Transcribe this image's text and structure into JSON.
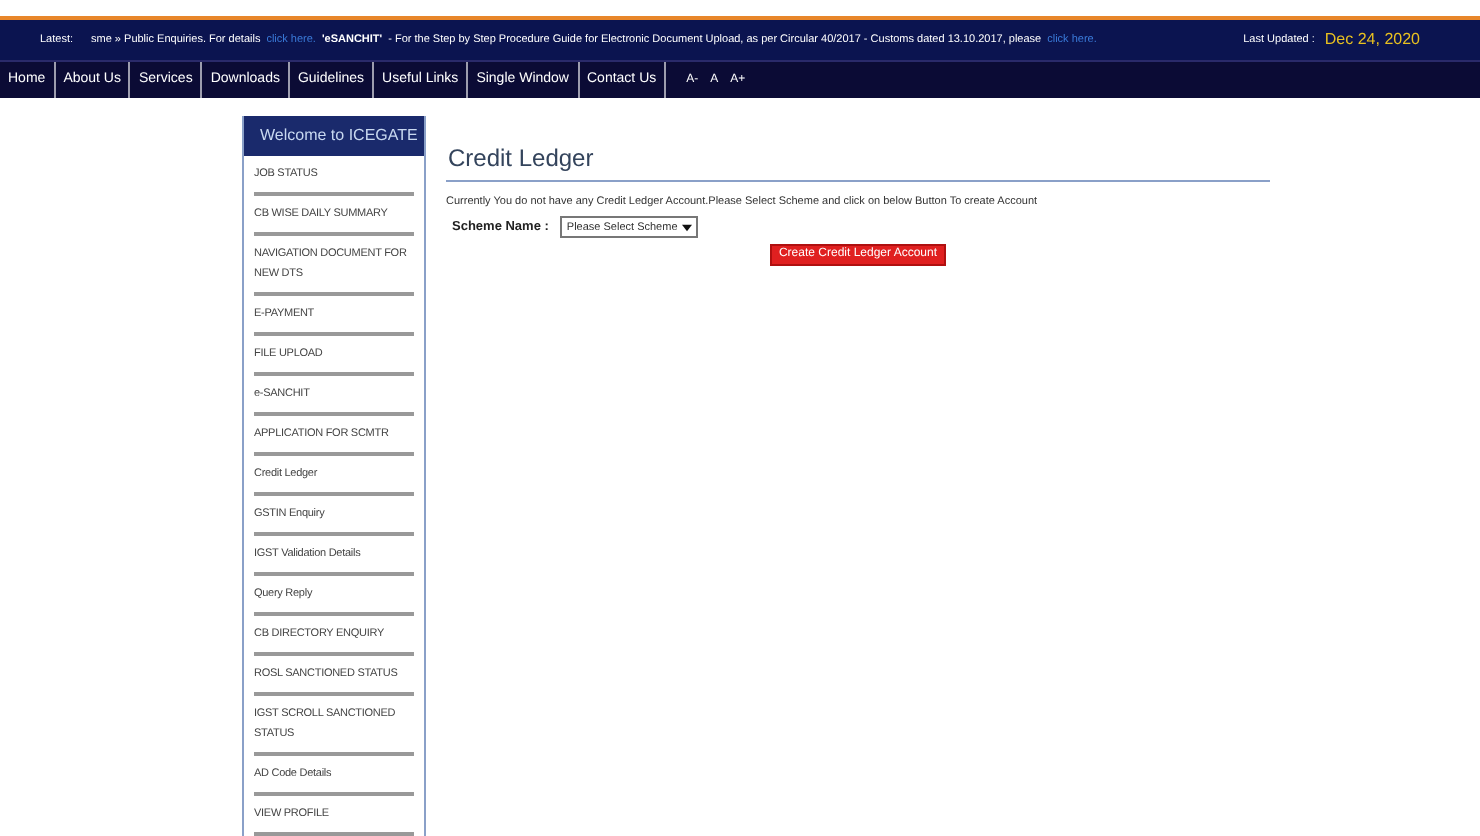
{
  "ticker": {
    "label": "Latest:",
    "items": [
      {
        "kind": "text",
        "text": "sme » Public Enquiries. For details"
      },
      {
        "kind": "link",
        "text": "click here."
      },
      {
        "kind": "bold",
        "text": "'eSANCHIT'"
      },
      {
        "kind": "text",
        "text": "- For the Step by Step Procedure Guide for Electronic Document Upload, as per Circular 40/2017 - Customs dated 13.10.2017, please"
      },
      {
        "kind": "link",
        "text": "click here."
      }
    ],
    "updated_label": "Last Updated :",
    "updated_date": "Dec 24, 2020"
  },
  "nav": [
    "Home",
    "About Us",
    "Services",
    "Downloads",
    "Guidelines",
    "Useful Links",
    "Single Window",
    "Contact Us"
  ],
  "font_sizes": [
    "A-",
    "A",
    "A+"
  ],
  "sidebar": {
    "title": "Welcome to ICEGATE",
    "items": [
      {
        "label": "JOB STATUS"
      },
      {
        "label": "CB WISE DAILY SUMMARY"
      },
      {
        "label": "NAVIGATION DOCUMENT FOR NEW DTS"
      },
      {
        "label": "E-PAYMENT"
      },
      {
        "label": "FILE UPLOAD"
      },
      {
        "label": "e-SANCHIT"
      },
      {
        "label": "APPLICATION FOR SCMTR"
      },
      {
        "label": "Credit Ledger"
      },
      {
        "label": "GSTIN Enquiry"
      },
      {
        "label": "IGST Validation Details"
      },
      {
        "label": "Query Reply"
      },
      {
        "label": "CB DIRECTORY ENQUIRY"
      },
      {
        "label": "ROSL SANCTIONED STATUS"
      },
      {
        "label": "IGST SCROLL SANCTIONED STATUS"
      },
      {
        "label": "AD Code Details"
      },
      {
        "label": "VIEW PROFILE"
      }
    ]
  },
  "main": {
    "title": "Credit Ledger",
    "message": "Currently You do not have any Credit Ledger Account.Please Select Scheme and click on below Button To create Account",
    "scheme_label": "Scheme Name :",
    "scheme_value": "Please Select Scheme",
    "button": "Create Credit Ledger Account"
  }
}
